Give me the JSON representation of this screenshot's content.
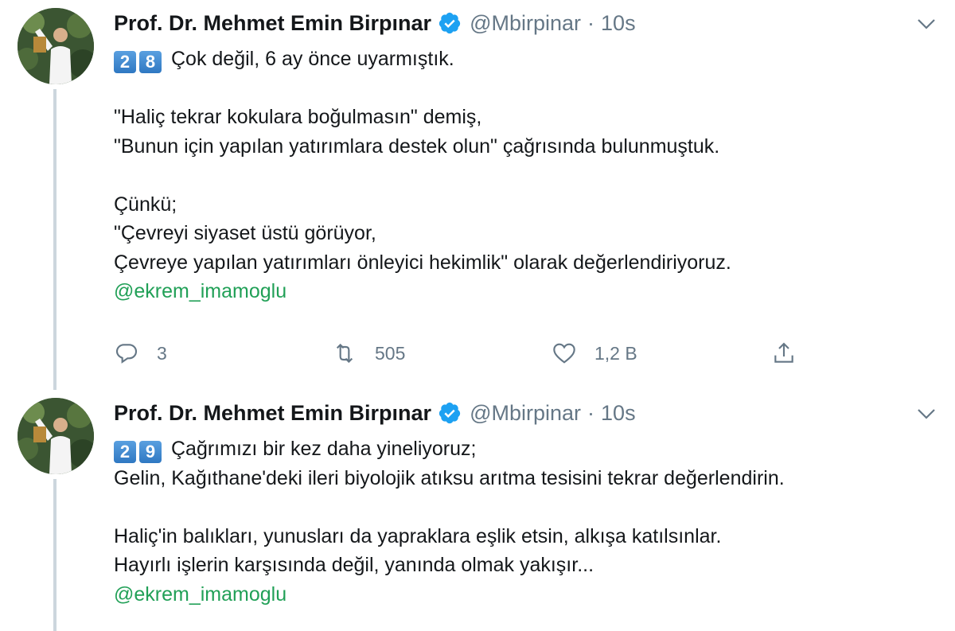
{
  "tweets": [
    {
      "display_name": "Prof. Dr. Mehmet Emin Birpınar",
      "handle": "@Mbirpinar",
      "separator": "·",
      "time": "10s",
      "avatar_icon": "profile-photo",
      "verified_icon": "verified-badge-icon",
      "keycaps": [
        "2",
        "8"
      ],
      "lines": [
        "Çok değil, 6 ay önce uyarmıştık.",
        "",
        "\"Haliç tekrar kokulara boğulmasın\" demiş,",
        "\"Bunun için yapılan yatırımlara destek olun\" çağrısında bulunmuştuk.",
        "",
        "Çünkü;",
        "\"Çevreyi siyaset üstü görüyor,",
        "Çevreye yapılan yatırımları önleyici hekimlik\" olarak değerlendiriyoruz."
      ],
      "mention": "@ekrem_imamoglu",
      "actions": {
        "reply_count": "3",
        "retweet_count": "505",
        "like_count": "1,2 B"
      }
    },
    {
      "display_name": "Prof. Dr. Mehmet Emin Birpınar",
      "handle": "@Mbirpinar",
      "separator": "·",
      "time": "10s",
      "avatar_icon": "profile-photo",
      "verified_icon": "verified-badge-icon",
      "keycaps": [
        "2",
        "9"
      ],
      "lines": [
        "Çağrımızı bir kez daha yineliyoruz;",
        "Gelin, Kağıthane'deki ileri biyolojik atıksu arıtma tesisini tekrar değerlendirin.",
        "",
        "Haliç'in balıkları, yunusları da yapraklara eşlik etsin, alkışa katılsınlar.",
        "Hayırlı işlerin karşısında değil, yanında olmak yakışır..."
      ],
      "mention": "@ekrem_imamoglu"
    }
  ],
  "colors": {
    "text": "#14171a",
    "secondary": "#657786",
    "mention": "#21a057",
    "verified": "#1da1f2",
    "thread_line": "#ccd6dd",
    "keycap": "#2f78c2"
  }
}
